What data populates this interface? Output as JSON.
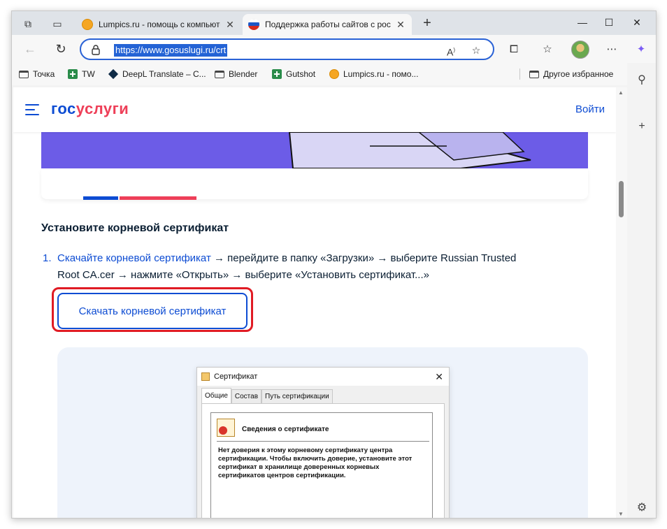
{
  "browser": {
    "tabs": [
      {
        "title": "Lumpics.ru - помощь с компьютером",
        "favicon": "lumpics-orange-icon",
        "active": false
      },
      {
        "title": "Поддержка работы сайтов с российскими сертификатами",
        "favicon": "russia-flag-icon",
        "active": true
      }
    ],
    "url": "https://www.gosuslugi.ru/crt",
    "favorites": [
      {
        "label": "Точка",
        "icon": "folder-icon"
      },
      {
        "label": "TW",
        "icon": "green-plus-icon"
      },
      {
        "label": "DeepL Translate – С...",
        "icon": "deepl-icon"
      },
      {
        "label": "Blender",
        "icon": "folder-icon"
      },
      {
        "label": "Gutshot",
        "icon": "green-plus-icon"
      },
      {
        "label": "Lumpics.ru - помо...",
        "icon": "lumpics-orange-icon"
      }
    ],
    "other_favorites": "Другое избранное"
  },
  "site": {
    "logo_part1": "гос",
    "logo_part2": "услуги",
    "login": "Войти",
    "colors": {
      "brand_blue": "#0d4cd3",
      "brand_red": "#ee3f58",
      "banner": "#6c5ce7"
    }
  },
  "content": {
    "heading": "Установите корневой сертификат",
    "step_number": "1.",
    "step_link": "Скачайте корневой сертификат",
    "step_text1": " → перейдите в папку «Загрузки» → выберите Russian Trusted",
    "step_text2": "Root CA.cer → нажмите «Открыть» → выберите «Установить сертификат...»",
    "download_button": "Скачать корневой сертификат",
    "highlight_color": "#e01b24"
  },
  "dialog": {
    "title": "Сертификат",
    "tabs": [
      "Общие",
      "Состав",
      "Путь сертификации"
    ],
    "heading": "Сведения о сертификате",
    "body": "Нет доверия к этому корневому сертификату центра сертификации. Чтобы включить доверие, установите этот сертификат в хранилище доверенных корневых сертификатов центров сертификации."
  }
}
